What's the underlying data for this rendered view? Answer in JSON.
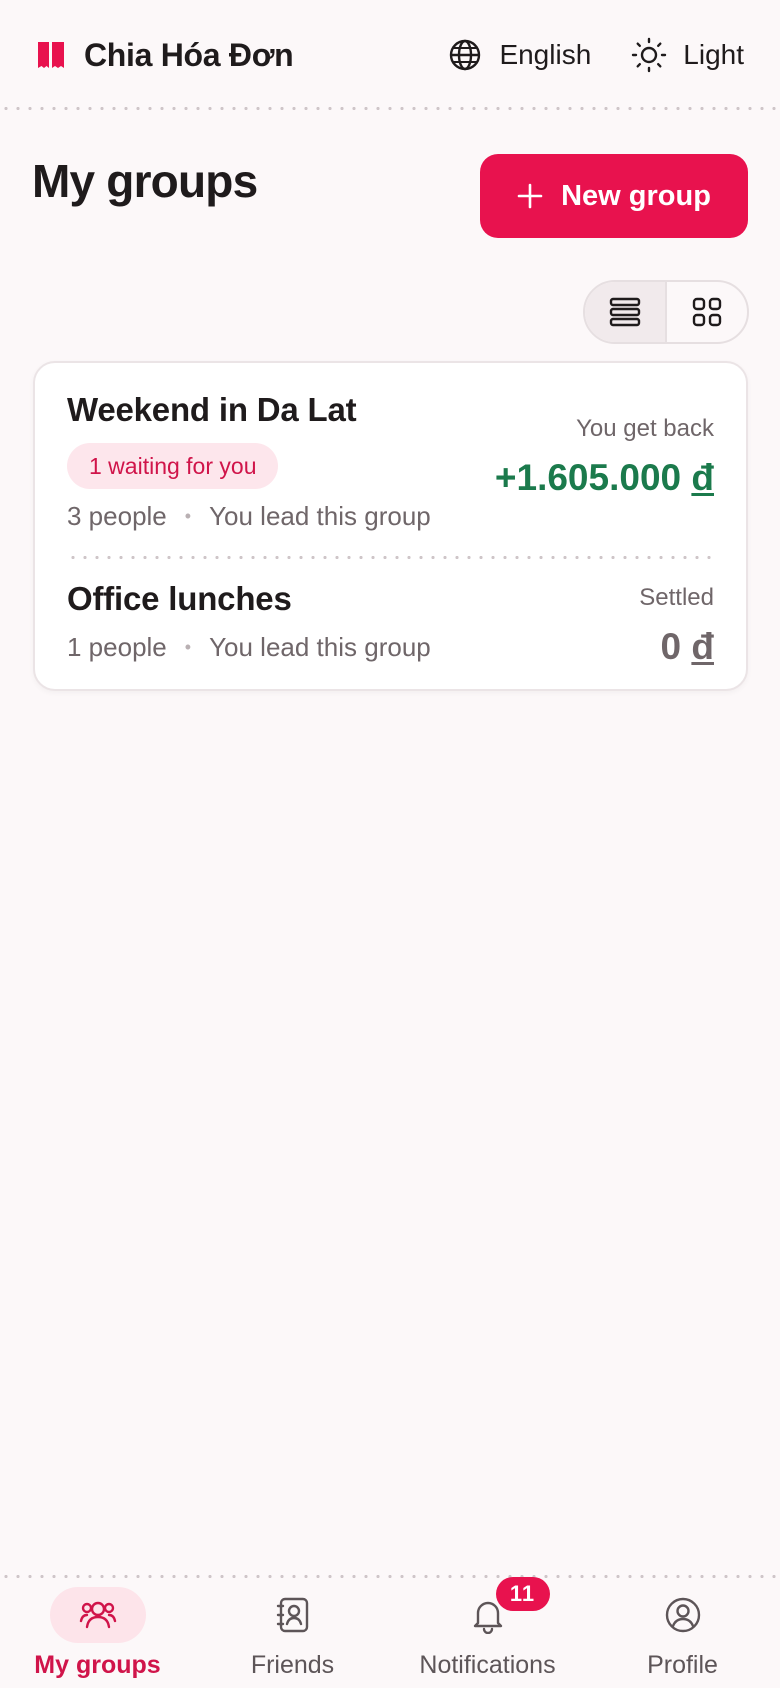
{
  "app": {
    "name": "Chia Hóa Đơn",
    "accent_color": "#e8124e"
  },
  "header": {
    "language_label": "English",
    "theme_label": "Light",
    "icons": {
      "logo": "receipt-logo-icon",
      "language": "globe-icon",
      "theme": "sun-icon"
    }
  },
  "main": {
    "title": "My groups",
    "new_group_label": "New group",
    "view_toggle": {
      "selected": "list",
      "options": [
        "list-view-icon",
        "grid-view-icon"
      ]
    },
    "groups": [
      {
        "name": "Weekend in Da Lat",
        "badge": "1 waiting for you",
        "people": "3 people",
        "role": "You lead this group",
        "balance_label": "You get back",
        "balance_value": "+1.605.000",
        "currency": "đ",
        "balance_color": "#1b7a4c"
      },
      {
        "name": "Office lunches",
        "people": "1 people",
        "role": "You lead this group",
        "balance_label": "Settled",
        "balance_value": "0",
        "currency": "đ",
        "balance_color": "#6f6669"
      }
    ]
  },
  "bottom_nav": {
    "items": [
      {
        "label": "My groups",
        "icon": "groups-icon",
        "active": true
      },
      {
        "label": "Friends",
        "icon": "contacts-icon",
        "active": false
      },
      {
        "label": "Notifications",
        "icon": "bell-icon",
        "active": false,
        "badge": "11"
      },
      {
        "label": "Profile",
        "icon": "user-circle-icon",
        "active": false
      }
    ]
  }
}
